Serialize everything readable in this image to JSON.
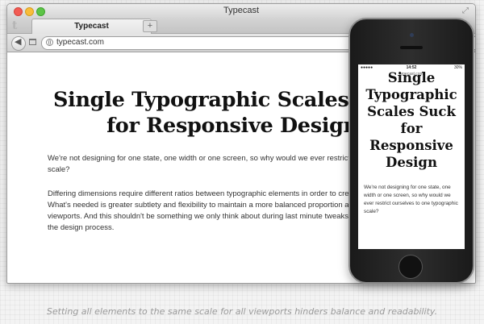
{
  "browser": {
    "window_title": "Typecast",
    "tab_label": "Typecast",
    "new_tab_label": "+",
    "back_glyph": "◀",
    "tab_logo_glyph": "t",
    "url": "typecast.com"
  },
  "page": {
    "headline": "Single Typographic Scales Suck for Responsive Design",
    "paragraph_1": "We're not designing for one state, one width or one screen, so why would we ever restrict ourselves to one typographic scale?",
    "paragraph_2": "Differing dimensions require different ratios between typographic elements in order to create harmonious experiences. What's needed is greater subtlety and flexibility to maintain a more balanced proportion and readability across viewports. And this shouldn't be something we only think about during last minute tweaks. We can deal with it early in the design process."
  },
  "phone": {
    "status_signal": "●●●●● ",
    "status_time": "14:52",
    "status_battery": "30%",
    "url": "typecast.com",
    "headline": "Single Typographic Scales Suck for Responsive Design",
    "paragraph": "We're not designing for one state, one width or one screen, so why would we ever restrict ourselves to one typographic scale?"
  },
  "caption": "Setting all elements to the same scale for all viewports hinders balance and readability.",
  "colors": {
    "close": "#f25b53",
    "minimize": "#f8bd3a",
    "zoom": "#5dc447",
    "caption_text": "#9a9a9a"
  },
  "icons": [
    "close-icon",
    "minimize-icon",
    "zoom-icon",
    "expand-icon",
    "back-arrow-icon",
    "bookmarks-icon",
    "globe-icon"
  ]
}
